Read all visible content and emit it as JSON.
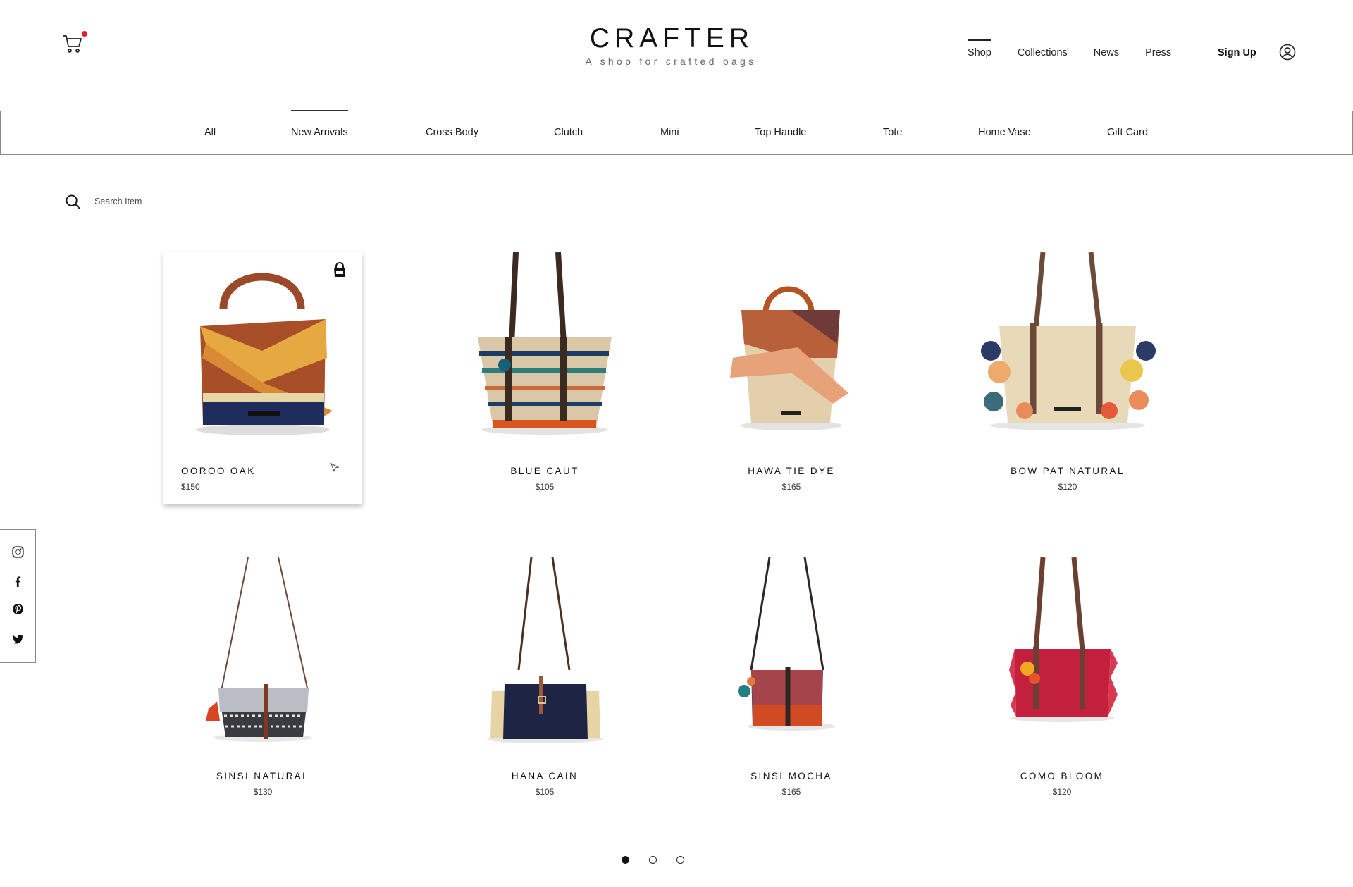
{
  "brand": {
    "title": "CRAFTER",
    "tagline": "A shop for crafted bags"
  },
  "header": {
    "cart_has_items": true,
    "nav": [
      "Shop",
      "Collections",
      "News",
      "Press"
    ],
    "active_nav": "Shop",
    "signup_label": "Sign Up"
  },
  "categories": {
    "items": [
      "All",
      "New Arrivals",
      "Cross Body",
      "Clutch",
      "Mini",
      "Top Handle",
      "Tote",
      "Home Vase",
      "Gift Card"
    ],
    "active": "New Arrivals"
  },
  "search": {
    "placeholder": "Search Item"
  },
  "social": [
    "instagram-icon",
    "facebook-icon",
    "pinterest-icon",
    "twitter-icon"
  ],
  "products": [
    {
      "name": "OOROO OAK",
      "price": "$150",
      "featured": true
    },
    {
      "name": "BLUE CAUT",
      "price": "$105"
    },
    {
      "name": "HAWA TIE DYE",
      "price": "$165"
    },
    {
      "name": "BOW PAT NATURAL",
      "price": "$120"
    },
    {
      "name": "SINSI NATURAL",
      "price": "$130"
    },
    {
      "name": "HANA CAIN",
      "price": "$105"
    },
    {
      "name": "SINSI MOCHA",
      "price": "$165"
    },
    {
      "name": "COMO BLOOM",
      "price": "$120"
    }
  ],
  "pagination": {
    "pages": 3,
    "current": 1
  },
  "colors": {
    "accent_dot": "#e41e26",
    "text": "#111111",
    "border": "#8a8a8a"
  }
}
